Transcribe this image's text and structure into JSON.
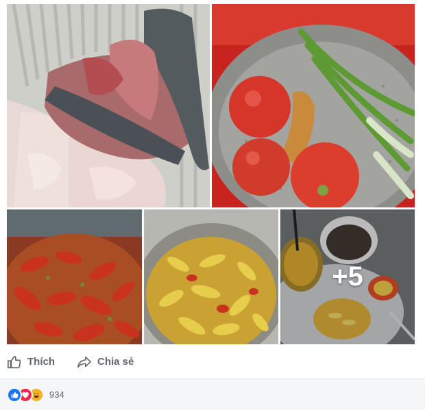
{
  "photos": [
    {
      "subject": "fish head and sliced fish in a white plastic basket"
    },
    {
      "subject": "tomatoes, turmeric root and green onions in a metal colander"
    },
    {
      "subject": "simmering soup pot with tomatoes"
    },
    {
      "subject": "yellow turmeric fish in pot"
    },
    {
      "subject": "plated dinner bowls",
      "more_label": "+5"
    }
  ],
  "actions": {
    "like_label": "Thích",
    "share_label": "Chia sẻ"
  },
  "reactions": {
    "icons": [
      "like-reaction-icon",
      "love-reaction-icon",
      "haha-reaction-icon"
    ],
    "count": "934"
  },
  "colors": {
    "like": "#1877f2",
    "love": "#f0284a",
    "haha": "#f7b125",
    "action_text": "#606770"
  }
}
